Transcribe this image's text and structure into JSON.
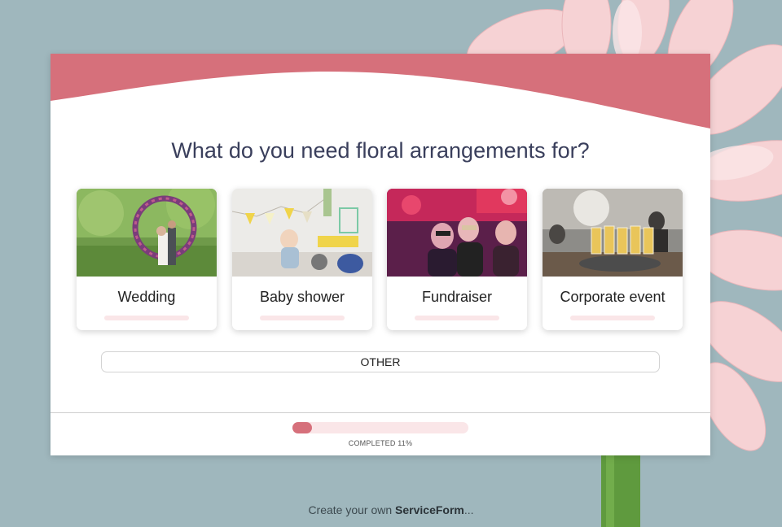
{
  "question": "What do you need floral arrangements for?",
  "options": [
    {
      "label": "Wedding"
    },
    {
      "label": "Baby shower"
    },
    {
      "label": "Fundraiser"
    },
    {
      "label": "Corporate event"
    }
  ],
  "other_label": "OTHER",
  "progress": {
    "text": "COMPLETED 11%",
    "percent": 11
  },
  "footer": {
    "prefix": "Create your own ",
    "brand": "ServiceForm",
    "suffix": "..."
  },
  "colors": {
    "accent": "#d6707b",
    "accent_light": "#fae6e8",
    "background": "#9fb7bd",
    "title": "#3a3f5c"
  }
}
